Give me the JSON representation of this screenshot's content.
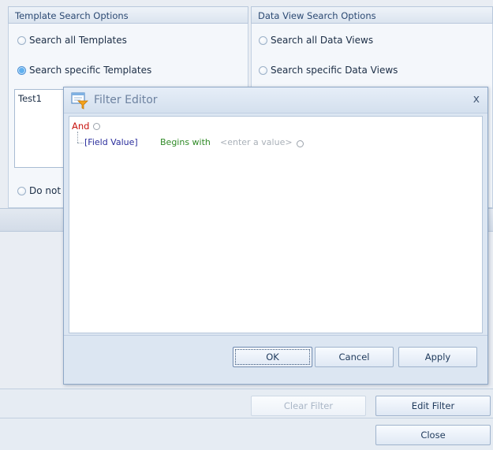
{
  "template_search": {
    "header": "Template Search Options",
    "options": [
      "Search all Templates",
      "Search specific Templates",
      "Do not"
    ],
    "list_items": [
      "Test1"
    ]
  },
  "dataview_search": {
    "header": "Data View Search Options",
    "options": [
      "Search all Data Views",
      "Search specific Data Views"
    ]
  },
  "dialog": {
    "title": "Filter Editor",
    "close_glyph": "x",
    "root_operator": "And",
    "condition": {
      "field": "[Field Value]",
      "operator": "Begins with",
      "value_placeholder": "<enter a value>"
    },
    "buttons": {
      "ok": "OK",
      "cancel": "Cancel",
      "apply": "Apply"
    }
  },
  "bottom": {
    "clear_filter": "Clear Filter",
    "edit_filter": "Edit Filter",
    "close": "Close"
  },
  "colors": {
    "accent": "#4a8fd4",
    "and_operator": "#c8140f",
    "field_name": "#2a2d9c",
    "condition_operator": "#2f8a26"
  }
}
